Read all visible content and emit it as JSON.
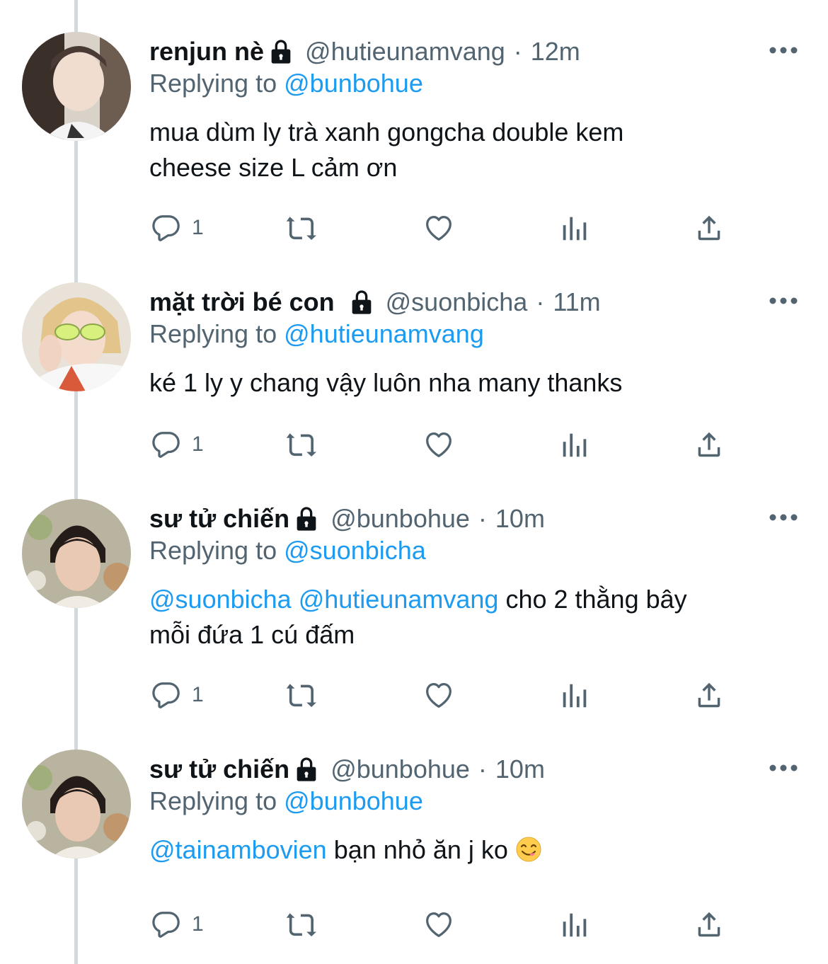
{
  "tweets": [
    {
      "name": "renjun nè",
      "handle": "@hutieunamvang",
      "dot": "·",
      "time": "12m",
      "replying_prefix": "Replying to",
      "replying_to": "@bunbohue",
      "text_line1": "mua dùm ly trà xanh gongcha double kem",
      "text_line2": "cheese size L cảm ơn",
      "reply_count": "1"
    },
    {
      "name": "mặt trời bé con",
      "handle": "@suonbicha",
      "dot": "·",
      "time": "11m",
      "replying_prefix": "Replying to",
      "replying_to": "@hutieunamvang",
      "text_line1": "ké 1 ly y chang vậy luôn nha many thanks",
      "reply_count": "1"
    },
    {
      "name": "sư tử chiến",
      "handle": "@bunbohue",
      "dot": "·",
      "time": "10m",
      "replying_prefix": "Replying to",
      "replying_to": "@suonbicha",
      "mention1": "@suonbicha",
      "mention2": "@hutieunamvang",
      "text_line1_rest": "cho 2 thằng bây",
      "text_line2": "mỗi đứa 1 cú đấm",
      "reply_count": "1"
    },
    {
      "name": "sư tử chiến",
      "handle": "@bunbohue",
      "dot": "·",
      "time": "10m",
      "replying_prefix": "Replying to",
      "replying_to": "@bunbohue",
      "mention1": "@tainambovien",
      "text_line1_rest": "bạn nhỏ ăn j ko",
      "emoji": "yum-face-emoji",
      "reply_count": "1"
    }
  ],
  "colors": {
    "link": "#1d9bf0",
    "secondary": "#536471",
    "thread_line": "#cfd9de"
  },
  "icons": [
    "lock-icon",
    "more-icon",
    "reply-icon",
    "retweet-icon",
    "like-icon",
    "analytics-icon",
    "share-icon"
  ]
}
